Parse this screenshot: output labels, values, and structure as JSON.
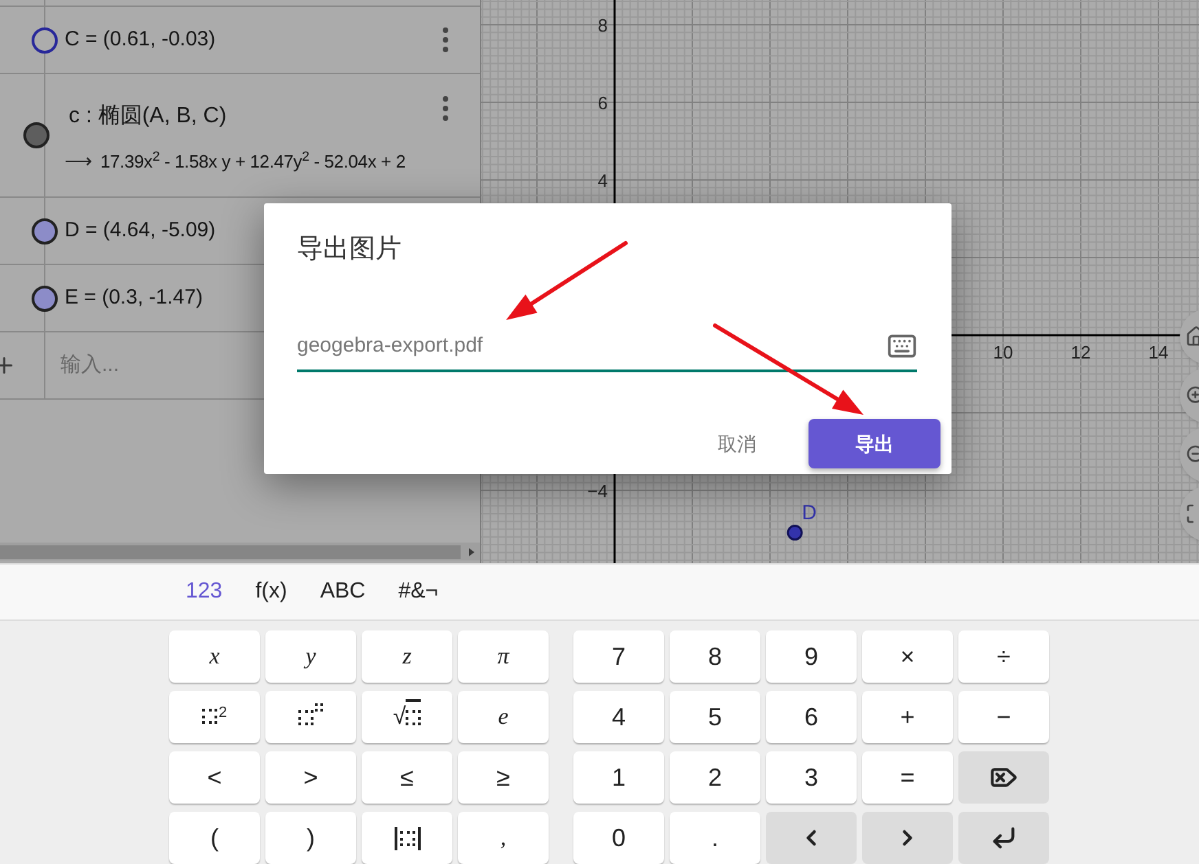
{
  "algebra": {
    "items": [
      {
        "kind": "point",
        "visible": false,
        "color": "#28289a",
        "text": "C = (0.61, -0.03)",
        "menu": true
      },
      {
        "kind": "conic",
        "visible": true,
        "color": "#5e5e5e",
        "definition": "c : 椭圆(A, B, C)",
        "arrow": "⟶",
        "value": "17.39x$^{2}$ - 1.58x y + 12.47y$^{2}$ - 52.04x + 2",
        "menu": true
      },
      {
        "kind": "point",
        "visible": true,
        "color": "#8c8cc8",
        "text": "D = (4.64, -5.09)",
        "menu": false
      },
      {
        "kind": "point",
        "visible": true,
        "color": "#8c8cc8",
        "text": "E = (0.3, -1.47)",
        "menu": false
      }
    ],
    "input": {
      "placeholder": "输入..."
    }
  },
  "graphics": {
    "y_labels": [
      "8",
      "6",
      "4",
      "−4"
    ],
    "x_labels": [
      "10",
      "12",
      "14"
    ],
    "point": {
      "label": "D"
    }
  },
  "dialog": {
    "title": "导出图片",
    "field": {
      "value": "geogebra-export.pdf"
    },
    "buttons": [
      {
        "label": "取消",
        "kind": "text"
      },
      {
        "label": "导出",
        "kind": "primary"
      }
    ]
  },
  "keyboard": {
    "tabs": [
      {
        "label": "123",
        "selected": true
      },
      {
        "label": "f(x)",
        "selected": false
      },
      {
        "label": "ABC",
        "selected": false
      },
      {
        "label": "#&¬",
        "selected": false
      }
    ],
    "left_keys": [
      [
        {
          "kind": "math",
          "label": "x"
        },
        {
          "kind": "math",
          "label": "y"
        },
        {
          "kind": "math",
          "label": "z"
        },
        {
          "kind": "math",
          "label": "π"
        }
      ],
      [
        {
          "kind": "square",
          "label": "2"
        },
        {
          "kind": "power"
        },
        {
          "kind": "sqrt",
          "label": "√"
        },
        {
          "kind": "math",
          "label": "e"
        }
      ],
      [
        {
          "kind": "text",
          "label": "<"
        },
        {
          "kind": "text",
          "label": ">"
        },
        {
          "kind": "text",
          "label": "≤"
        },
        {
          "kind": "text",
          "label": "≥"
        }
      ],
      [
        {
          "kind": "text",
          "label": "("
        },
        {
          "kind": "text",
          "label": ")"
        },
        {
          "kind": "abs"
        },
        {
          "kind": "math",
          "label": ","
        }
      ]
    ],
    "right_keys": [
      [
        {
          "kind": "text",
          "label": "7"
        },
        {
          "kind": "text",
          "label": "8"
        },
        {
          "kind": "text",
          "label": "9"
        },
        {
          "kind": "text",
          "label": "×"
        },
        {
          "kind": "text",
          "label": "÷"
        }
      ],
      [
        {
          "kind": "text",
          "label": "4"
        },
        {
          "kind": "text",
          "label": "5"
        },
        {
          "kind": "text",
          "label": "6"
        },
        {
          "kind": "text",
          "label": "+"
        },
        {
          "kind": "text",
          "label": "−"
        }
      ],
      [
        {
          "kind": "text",
          "label": "1"
        },
        {
          "kind": "text",
          "label": "2"
        },
        {
          "kind": "text",
          "label": "3"
        },
        {
          "kind": "text",
          "label": "="
        },
        {
          "kind": "backspace"
        }
      ],
      [
        {
          "kind": "text",
          "label": "0"
        },
        {
          "kind": "text",
          "label": "."
        },
        {
          "kind": "left"
        },
        {
          "kind": "right"
        },
        {
          "kind": "enter"
        }
      ]
    ]
  }
}
